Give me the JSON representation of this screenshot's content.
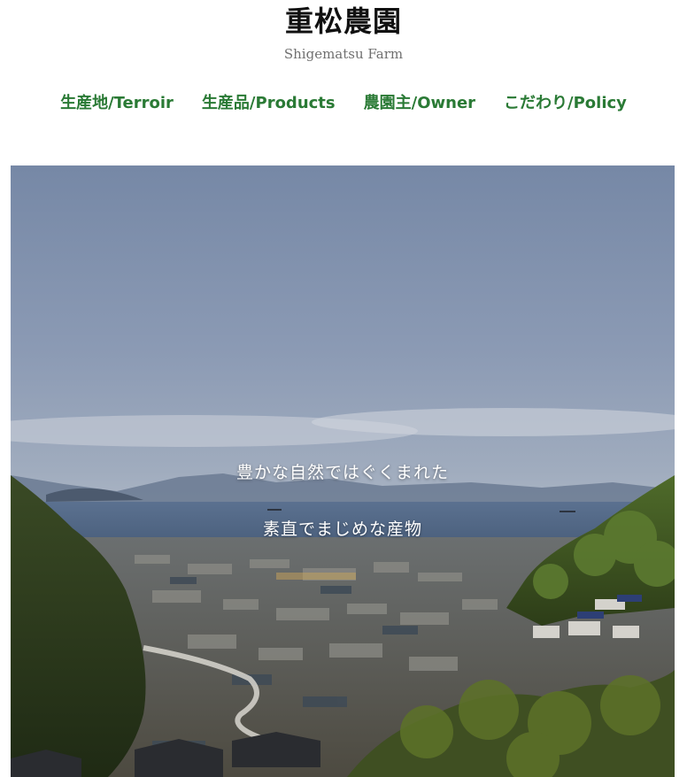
{
  "site": {
    "title": "重松農園",
    "subtitle": "Shigematsu Farm"
  },
  "nav": {
    "items": [
      {
        "label": "生産地/Terroir"
      },
      {
        "label": "生産品/Products"
      },
      {
        "label": "農園主/Owner"
      },
      {
        "label": "こだわり/Policy"
      }
    ]
  },
  "hero": {
    "line1": "豊かな自然ではぐくまれた",
    "line2": "素直でまじめな産物"
  }
}
